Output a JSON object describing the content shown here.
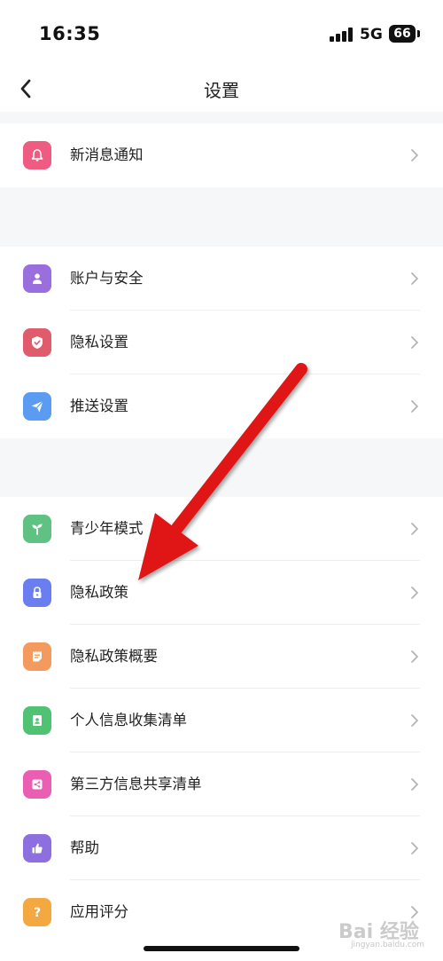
{
  "status_bar": {
    "time": "16:35",
    "network": "5G",
    "battery": "66"
  },
  "nav": {
    "title": "设置",
    "back_icon": "chevron-left-icon"
  },
  "sections": [
    {
      "items": [
        {
          "label": "新消息通知",
          "icon": "bell-icon",
          "color": "#ee5c82"
        }
      ]
    },
    {
      "items": [
        {
          "label": "账户与安全",
          "icon": "user-icon",
          "color": "#9a6fdd"
        },
        {
          "label": "隐私设置",
          "icon": "shield-icon",
          "color": "#e05c6d"
        },
        {
          "label": "推送设置",
          "icon": "send-icon",
          "color": "#5b9cf2"
        }
      ]
    },
    {
      "items": [
        {
          "label": "青少年模式",
          "icon": "sprout-icon",
          "color": "#5fc282"
        },
        {
          "label": "隐私政策",
          "icon": "lock-icon",
          "color": "#6a7ef0"
        },
        {
          "label": "隐私政策概要",
          "icon": "note-icon",
          "color": "#f49a5e"
        },
        {
          "label": "个人信息收集清单",
          "icon": "id-card-icon",
          "color": "#4fc274"
        },
        {
          "label": "第三方信息共享清单",
          "icon": "share-icon",
          "color": "#ea5fb3"
        },
        {
          "label": "帮助",
          "icon": "thumbs-up-icon",
          "color": "#8d6fe0"
        },
        {
          "label": "应用评分",
          "icon": "question-icon",
          "color": "#f3a840"
        }
      ]
    }
  ],
  "annotation": {
    "arrow_color": "#e01818",
    "points_to": "隐私政策"
  },
  "watermark": {
    "brand": "Bai 经验",
    "url": "jingyan.baidu.com"
  }
}
